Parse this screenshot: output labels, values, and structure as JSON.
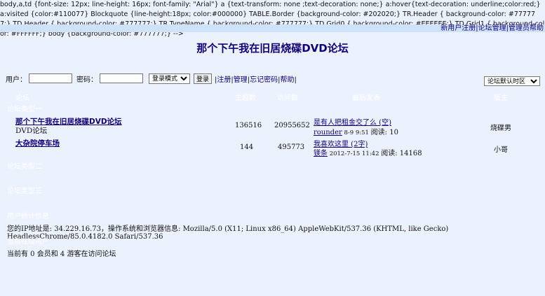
{
  "css_leak_text": "body,a,td {font-size: 12px; line-height: 16px; font-family: \"Arial\"} a {text-transform: none ;text-decoration: none;} a:hover{text-decoration: underline;color:red;} a:visited {color:#110077} Blockquote {line-height:18px; color:#000000} TABLE.Border {background-color: #202020;} TR.Header { background-color: #777777;} TD.Header { background-color: #777777;} TR.TypeName { background-color: #777777;} TD.Grid0 { background-color: #EEEEEE;} TD.Grid1 { background-color: #FFFFFF;} body {background-color: #777777;} -->",
  "top_links": [
    "新用户注册",
    "论坛管理",
    "管理员帮助"
  ],
  "site_title": "那个下午我在旧居烧碟DVD论坛",
  "login": {
    "user_label": "用户：",
    "password_label": "密码：",
    "mode_option": "登录模式",
    "login_button": "登录",
    "links": [
      "注册",
      "管理",
      "忘记密码",
      "帮助"
    ]
  },
  "zone_select": "论坛默认时区",
  "table_headers": {
    "forum": "论坛",
    "topics": "主题数",
    "views": "访问数",
    "last_post": "最后发表",
    "owner": "版主"
  },
  "categories": [
    "论坛类型一",
    "论坛类型二",
    "论坛类型三"
  ],
  "forums": [
    {
      "name": "那个下午我在旧居烧碟DVD论坛",
      "desc": "DVD论坛",
      "topics": "136516",
      "views": "20955652",
      "last_title": "是有人把租金交了么 (空)",
      "last_user": "rounder",
      "last_time": "8-9 9:51",
      "last_reads": "阅读: 10",
      "owner": "烧碟男"
    },
    {
      "name": "大杂院停车场",
      "desc": "",
      "topics": "144",
      "views": "495773",
      "last_title": "我喜欢这里 (2字)",
      "last_user": "镁条",
      "last_time": "2012-7-15 11:42",
      "last_reads": "阅读: 14168",
      "owner": "小哥"
    }
  ],
  "stats_header": "用户统计信息",
  "ip_info": "您的IP地址是: 34.229.16.73，操作系统和浏览器信息: Mozilla/5.0 (X11; Linux x86_64) AppleWebKit/537.36 (KHTML, like Gecko) HeadlessChrome/85.0.4182.0 Safari/537.36",
  "online_header": "当前在线用户",
  "online_info": "当前有 0 会员和 4 游客在访问论坛"
}
